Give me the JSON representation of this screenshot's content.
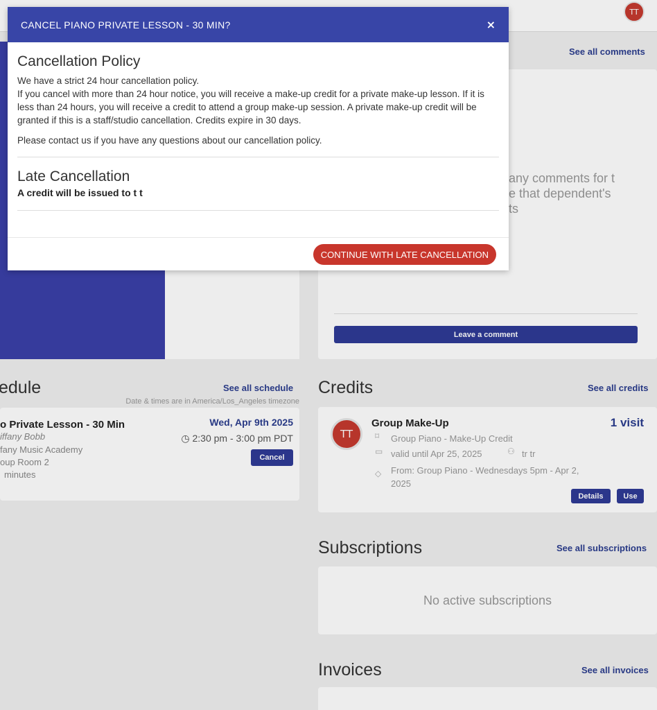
{
  "topbar": {
    "avatar_initials": "TT"
  },
  "comments": {
    "see_all": "See all comments",
    "empty_text": "any comments for t\ne that dependent's\nts",
    "leave_button": "Leave a comment"
  },
  "schedule": {
    "title": "edule",
    "see_all": "See all schedule",
    "timezone_note": "Date & times are in America/Los_Angeles timezone",
    "lesson": {
      "title": "o Private Lesson - 30 Min",
      "teacher": "iffany Bobb",
      "academy": "fany Music Academy",
      "room": "oup Room 2",
      "duration": "minutes",
      "date": "Wed, Apr 9th 2025",
      "time": "2:30 pm - 3:00 pm PDT",
      "cancel_button": "Cancel"
    }
  },
  "credits": {
    "title": "Credits",
    "see_all": "See all credits",
    "item": {
      "avatar_initials": "TT",
      "name": "Group Make-Up",
      "visits": "1 visit",
      "type": "Group Piano - Make-Up Credit",
      "valid_until": "valid until Apr 25, 2025",
      "student": "tr tr",
      "from": "From: Group Piano - Wednesdays 5pm - Apr 2, 2025",
      "details_button": "Details",
      "use_button": "Use"
    }
  },
  "subscriptions": {
    "title": "Subscriptions",
    "see_all": "See all subscriptions",
    "empty_text": "No active subscriptions"
  },
  "invoices": {
    "title": "Invoices",
    "see_all": "See all invoices"
  },
  "modal": {
    "title": "CANCEL PIANO PRIVATE LESSON - 30 MIN?",
    "close_glyph": "×",
    "policy_heading": "Cancellation Policy",
    "policy_line1": "We have a strict 24 hour cancellation policy.",
    "policy_line2": "If you cancel with more than 24 hour notice, you will receive a make-up credit for a private make-up lesson. If it is less than 24 hours, you will receive a credit to attend a group make-up session. A private make-up credit will be granted if this is a staff/studio cancellation. Credits expire in 30 days.",
    "policy_contact": "Please contact us if you have any questions about our cancellation policy.",
    "late_heading": "Late Cancellation",
    "late_text": "A credit will be issued to t t",
    "continue_button": "CONTINUE WITH LATE CANCELLATION"
  },
  "colors": {
    "brand_blue": "#3845a7",
    "danger_red": "#c8362c",
    "link_blue": "#2c3e8f"
  }
}
